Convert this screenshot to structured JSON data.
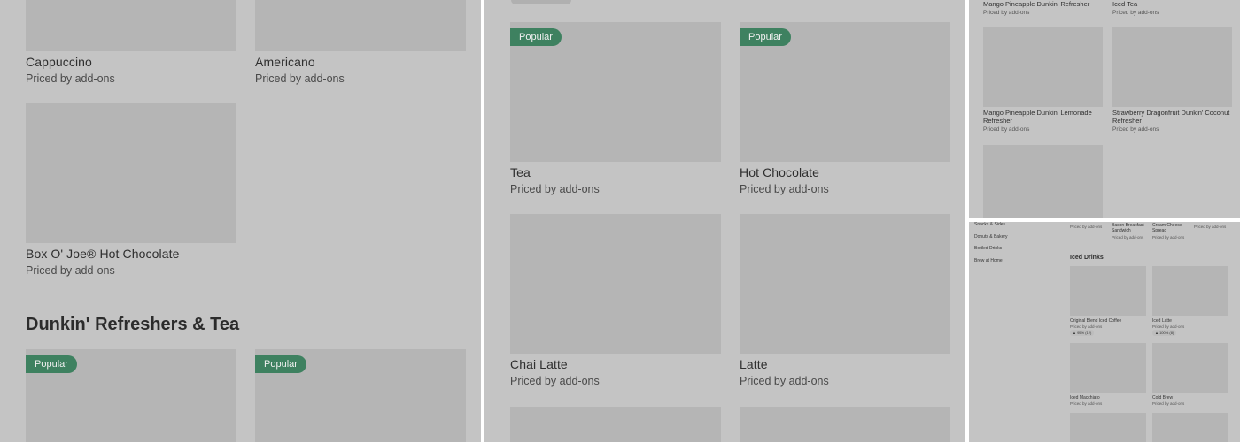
{
  "panel1": {
    "items_top": [
      {
        "name": "Cappuccino",
        "price": "Priced by add-ons"
      },
      {
        "name": "Americano",
        "price": "Priced by add-ons"
      }
    ],
    "item_mid": {
      "name": "Box O' Joe® Hot Chocolate",
      "price": "Priced by add-ons"
    },
    "section_title": "Dunkin' Refreshers & Tea",
    "badges": [
      "Popular",
      "Popular"
    ]
  },
  "panel2": {
    "row1": [
      {
        "name": "Tea",
        "price": "Priced by add-ons",
        "badge": "Popular"
      },
      {
        "name": "Hot Chocolate",
        "price": "Priced by add-ons",
        "badge": "Popular"
      }
    ],
    "row2": [
      {
        "name": "Chai Latte",
        "price": "Priced by add-ons"
      },
      {
        "name": "Latte",
        "price": "Priced by add-ons"
      }
    ]
  },
  "panel3": {
    "top_items": [
      {
        "name": "Mango Pineapple Dunkin' Refresher",
        "price": "Priced by add-ons"
      },
      {
        "name": "Iced Tea",
        "price": "Priced by add-ons"
      }
    ],
    "row": [
      {
        "name": "Mango Pineapple Dunkin' Lemonade Refresher",
        "price": "Priced by add-ons"
      },
      {
        "name": "Strawberry Dragonfruit Dunkin' Coconut Refresher",
        "price": "Priced by add-ons"
      }
    ]
  },
  "panel4": {
    "nav": [
      "Snacks & Sides",
      "Donuts & Bakery",
      "Bottled Drinks",
      "Brew at Home"
    ],
    "top_items": [
      {
        "name": "",
        "price": "Priced by add-ons"
      },
      {
        "name": "Bacon Breakfast Sandwich",
        "price": "Priced by add-ons"
      },
      {
        "name": "Cream Cheese Spread",
        "price": "Priced by add-ons"
      },
      {
        "name": "",
        "price": "Priced by add-ons"
      }
    ],
    "section_title": "Iced Drinks",
    "items": [
      {
        "name": "Original Blend Iced Coffee",
        "price": "Priced by add-ons",
        "rating": "▲ 95% (12)"
      },
      {
        "name": "Iced Latte",
        "price": "Priced by add-ons",
        "rating": "▲ 100% (8)"
      },
      {
        "name": "Iced Macchiato",
        "price": "Priced by add-ons"
      },
      {
        "name": "Cold Brew",
        "price": "Priced by add-ons"
      }
    ]
  }
}
